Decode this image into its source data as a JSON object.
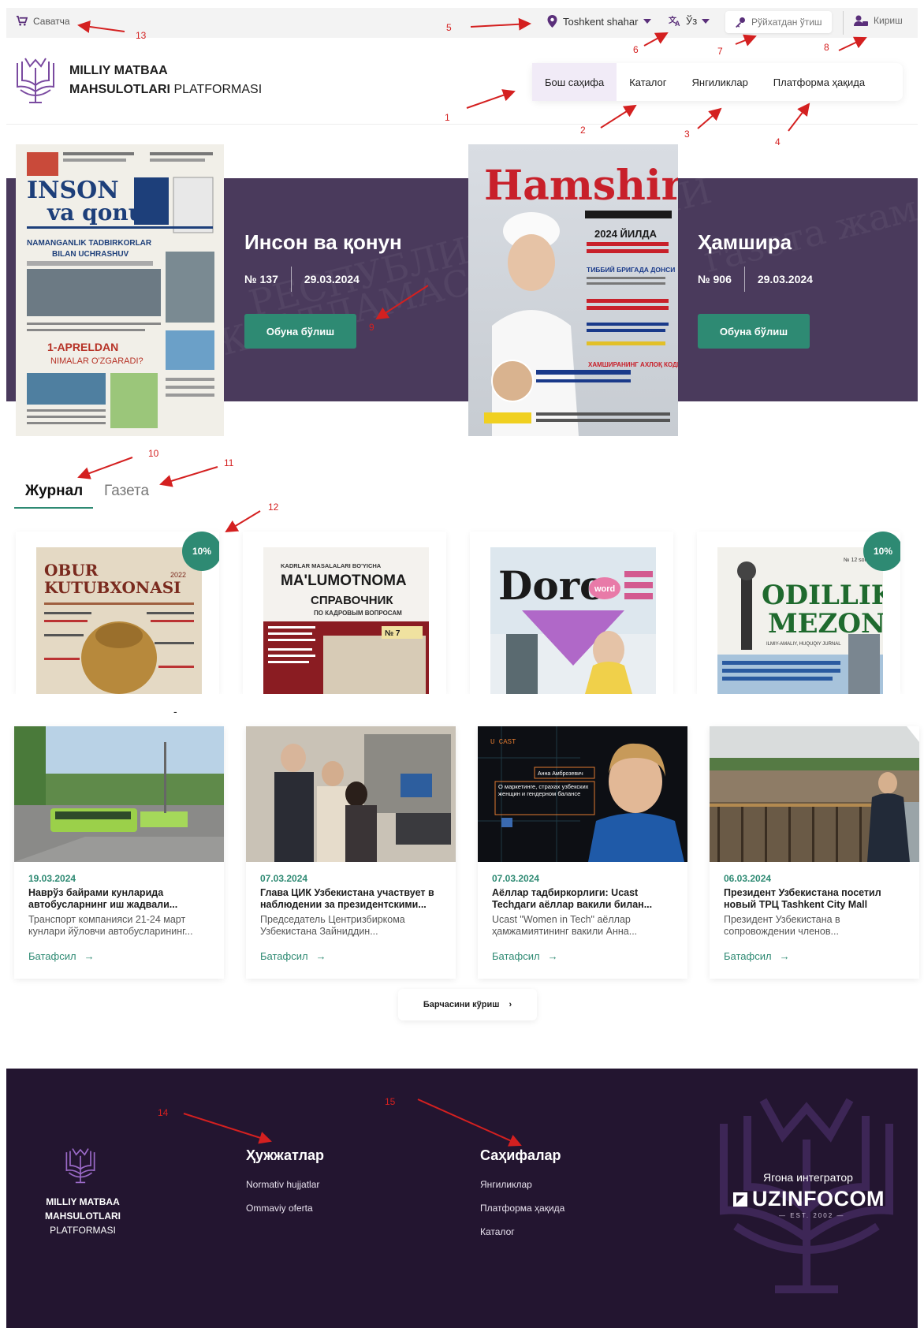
{
  "topbar": {
    "cart_label": "Саватча",
    "city": "Toshkent shahar",
    "language": "Ўз",
    "register_label": "Рўйхатдан ўтиш",
    "login_label": "Кириш"
  },
  "header": {
    "logo_line1": "MILLIY MATBAA",
    "logo_line2_bold": "MAHSULOTLARI",
    "logo_line2_light": "PLATFORMASI",
    "nav": [
      "Бош саҳифа",
      "Каталог",
      "Янгиликлар",
      "Платформа ҳақида"
    ],
    "active_nav": 0
  },
  "hero": {
    "slides": [
      {
        "title": "Инсон ва қонун",
        "number": "№ 137",
        "date": "29.03.2024",
        "button": "Обуна бўлиш",
        "cover": {
          "bg": "#f1efe8",
          "masthead_1": "INSON",
          "masthead_2": "va qonun",
          "headline": "NAMANGANLIK TADBIRKORLAR BILAN UCHRASHUV",
          "headline_2": "1-APRELDAN",
          "headline_3": "NIMALAR O'ZGARADI?"
        }
      },
      {
        "title": "Ҳамшира",
        "number": "№ 906",
        "date": "29.03.2024",
        "button": "Обуна бўлиш",
        "cover": {
          "bg": "#cfd8de",
          "masthead": "Hamshira",
          "headline_1": "2024 ЙИЛДА",
          "headline_2": "ТИББИЙ БРИГАДА ДОНСИ",
          "headline_3": "ХАМШИРАНИНГ АХЛОҚ КОДЕКСИ"
        }
      }
    ]
  },
  "tabs": {
    "journal": "Журнал",
    "newspaper": "Газета"
  },
  "products": [
    {
      "badge": "10%",
      "cover_bg": "#e4d9c4",
      "cover_title_1": "OBUR",
      "cover_title_2": "KUTUBXONASI",
      "cover_year": "2022"
    },
    {
      "badge": "",
      "cover_bg": "#f4f2ee",
      "cover_title_1": "KADRLAR MASALALARI BO'YICHA",
      "cover_title_2": "MA'LUMOTNOMA",
      "cover_title_3": "СПРАВОЧНИК",
      "cover_sub": "ПО КАДРОВЫМ ВОПРОСАМ",
      "cover_num": "№ 7"
    },
    {
      "badge": "",
      "cover_bg": "#e9eef2",
      "cover_title_1": "Doro",
      "cover_title_2": "word"
    },
    {
      "badge": "10%",
      "cover_bg": "#f2f1ec",
      "cover_title_1": "ODILLIK",
      "cover_title_2": "MEZONI",
      "cover_sub": "ILMIY-AMALIY, HUQUQIY JURNAL",
      "cover_num": "№ 12 son"
    }
  ],
  "dash": "-",
  "news": [
    {
      "date": "19.03.2024",
      "title": "Наврўз байрами кунларида автобусларнинг иш жадвали...",
      "desc": "Транспорт компанияси 21-24 март кунлари йўловчи автобусларининг...",
      "more": "Батафсил"
    },
    {
      "date": "07.03.2024",
      "title": "Глава ЦИК Узбекистана участвует в наблюдении за президентскими...",
      "desc": "Председатель Центризбиркома Узбекистана Зайниддин...",
      "more": "Батафсил"
    },
    {
      "date": "07.03.2024",
      "title": "Аёллар тадбиркорлиги: Ucast Techдаги аёллар вакили билан...",
      "desc": "Ucast \"Women in Tech\" аёллар ҳамжамиятининг вакили Анна...",
      "more": "Батафсил",
      "img_text_1": "Анна Амброзевич",
      "img_text_2": "О маркетинге, страхах узбекских женщин и гендерном балансе",
      "img_brand": "U CAST"
    },
    {
      "date": "06.03.2024",
      "title": "Президент Узбекистана посетил новый ТРЦ Tashkent City Mall",
      "desc": "Президент Узбекистана в сопровождении членов...",
      "more": "Батафсил"
    }
  ],
  "see_all": "Барчасини кўриш",
  "footer": {
    "logo_line1": "MILLIY MATBAA",
    "logo_line2": "MAHSULOTLARI",
    "logo_line3": "PLATFORMASI",
    "docs_title": "Ҳужжатлар",
    "docs_links": [
      "Normativ hujjatlar",
      "Ommaviy oferta"
    ],
    "pages_title": "Саҳифалар",
    "pages_links": [
      "Янгиликлар",
      "Платформа ҳақида",
      "Каталог"
    ],
    "integrator_label": "Ягона интегратор",
    "integrator_name": "UZINFOCOM",
    "integrator_est": "— EST. 2002 —"
  },
  "annotations": [
    "1",
    "2",
    "3",
    "4",
    "5",
    "6",
    "7",
    "8",
    "9",
    "10",
    "11",
    "12",
    "13",
    "14",
    "15"
  ],
  "colors": {
    "accent": "#2e8a73",
    "brand_purple": "#5a2f7a",
    "hero_bg": "#4a3a5c",
    "footer_bg": "#231530",
    "annotation": "#d42020"
  }
}
